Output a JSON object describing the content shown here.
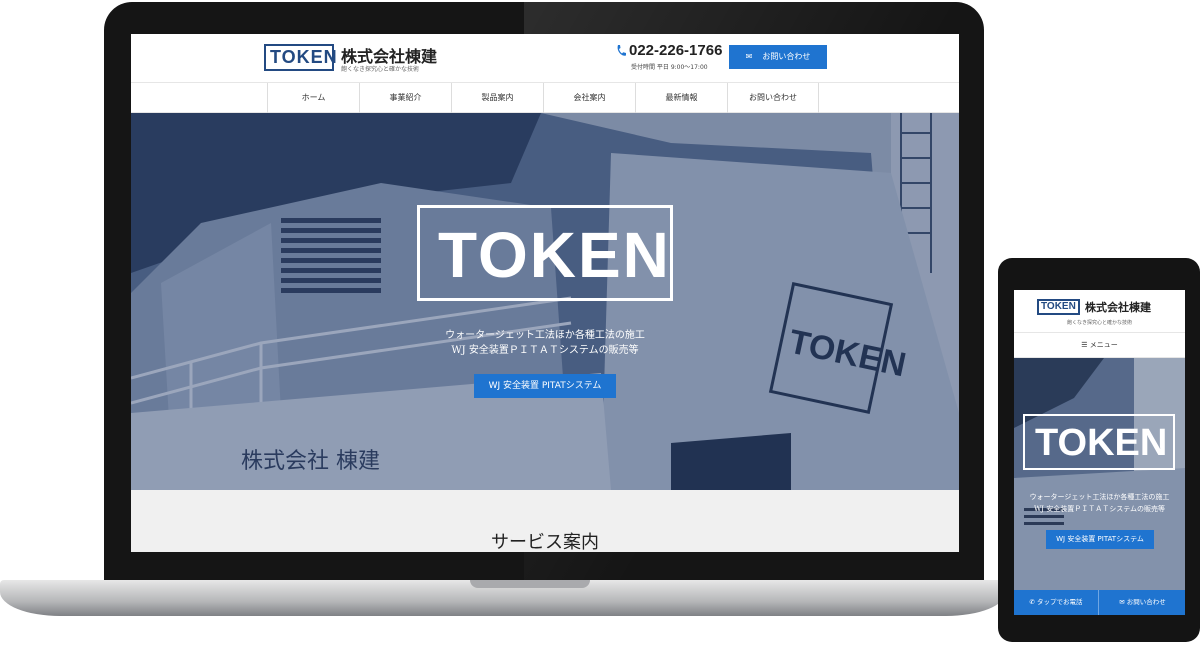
{
  "brand": {
    "logo_text": "TOKEN",
    "company_name": "株式会社棟建",
    "tagline": "飽くなき探究心と確かな技術"
  },
  "header": {
    "phone": "022-226-1766",
    "hours": "受付時間 平日 9:00〜17:00",
    "contact_label": "お問い合わせ"
  },
  "nav": [
    "ホーム",
    "事業紹介",
    "製品案内",
    "会社案内",
    "最新情報",
    "お問い合わせ"
  ],
  "hero": {
    "logo_text": "TOKEN",
    "line1": "ウォータージェット工法ほか各種工法の施工",
    "line2": "WJ 安全装置ＰＩＴＡＴシステムの販売等",
    "button": "WJ 安全装置 PITATシステム",
    "truck_logo": "TOKEN",
    "truck_lettering": "株式会社 棟建"
  },
  "service": {
    "title": "サービス案内"
  },
  "mobile": {
    "menu_label": "メニュー",
    "tel_label": "タップでお電話",
    "mail_label": "お問い合わせ"
  },
  "colors": {
    "accent": "#1f74d0",
    "logo_blue": "#234a82",
    "hero_tint": "#4e6282"
  }
}
